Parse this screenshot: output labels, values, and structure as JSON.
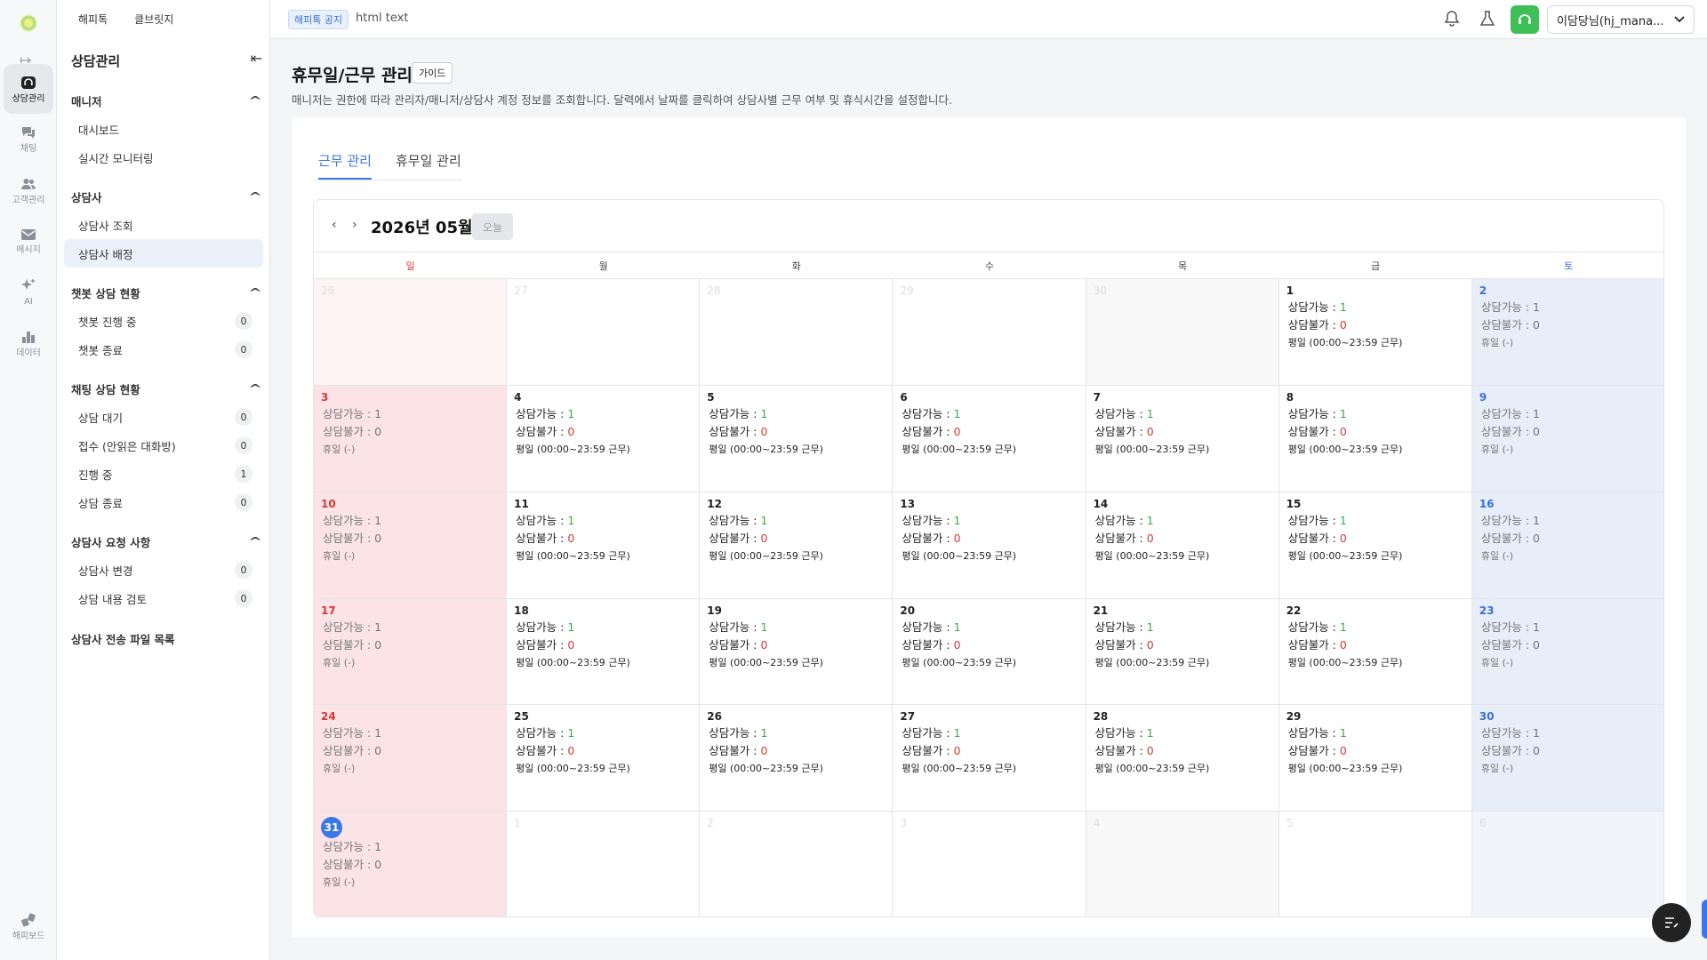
{
  "rail": {
    "items": [
      {
        "label": "상담관리",
        "icon": "headset-box-icon",
        "active": true
      },
      {
        "label": "채팅",
        "icon": "chat-icon",
        "active": false
      },
      {
        "label": "고객관리",
        "icon": "users-icon",
        "active": false
      },
      {
        "label": "메시지",
        "icon": "mail-icon",
        "active": false
      },
      {
        "label": "AI",
        "icon": "sparkle-icon",
        "active": false
      },
      {
        "label": "데이터",
        "icon": "bar-chart-icon",
        "active": false
      }
    ],
    "bottom": {
      "label": "해피보드",
      "icon": "board-icon"
    }
  },
  "sidebar": {
    "tabs": [
      "해피톡",
      "클브릿지"
    ],
    "title": "상담관리",
    "groups": [
      {
        "label": "매니저",
        "items": [
          {
            "label": "대시보드"
          },
          {
            "label": "실시간 모니터링"
          }
        ]
      },
      {
        "label": "상담사",
        "items": [
          {
            "label": "상담사 조회"
          },
          {
            "label": "상담사 배정",
            "active": true
          }
        ]
      },
      {
        "label": "챗봇 상담 현황",
        "items": [
          {
            "label": "챗봇 진행 중",
            "count": "0"
          },
          {
            "label": "챗봇 종료",
            "count": "0"
          }
        ]
      },
      {
        "label": "채팅 상담 현황",
        "items": [
          {
            "label": "상담 대기",
            "count": "0"
          },
          {
            "label": "접수 (안읽은 대화방)",
            "count": "0"
          },
          {
            "label": "진행 중",
            "count": "1"
          },
          {
            "label": "상담 종료",
            "count": "0"
          }
        ]
      },
      {
        "label": "상담사 요청 사항",
        "items": [
          {
            "label": "상담사 변경",
            "count": "0"
          },
          {
            "label": "상담 내용 검토",
            "count": "0"
          }
        ]
      }
    ],
    "footer_link": "상담사 전송 파일 목록"
  },
  "topbar": {
    "notice_tag": "해피톡 공지",
    "notice_text": "html text",
    "user": "이담당님(hj_mana..."
  },
  "page": {
    "title": "휴무일/근무 관리",
    "guide_label": "가이드",
    "description": "매니저는 권한에 따라 관리자/매니저/상담사 계정 정보를 조회합니다. 달력에서 날짜를 클릭하여 상담사별 근무 여부 및 휴식시간을 설정합니다.",
    "tabs": [
      {
        "label": "근무 관리",
        "active": true
      },
      {
        "label": "휴무일 관리",
        "active": false
      }
    ]
  },
  "calendar": {
    "month_label": "2026년 05월",
    "today_label": "오늘",
    "weekdays": [
      "일",
      "월",
      "화",
      "수",
      "목",
      "금",
      "토"
    ],
    "labels": {
      "available": "상담가능 : ",
      "unavailable": "상담불가 : ",
      "weekday": "평일 (00:00~23:59 근무)",
      "holiday": "휴일 (-)"
    },
    "available_count": "1",
    "unavailable_count": "0",
    "today_day": 31,
    "leading_days": [
      26,
      27,
      28,
      29,
      30
    ],
    "days_in_month": 31,
    "trailing_days": [
      1,
      2,
      3,
      4,
      5,
      6
    ]
  },
  "colors": {
    "accent": "#3b78e7",
    "sunday_bg": "#fbe3e6",
    "saturday_bg": "#e7edf9",
    "available": "#3aa84a",
    "unavailable": "#d63a3a"
  }
}
